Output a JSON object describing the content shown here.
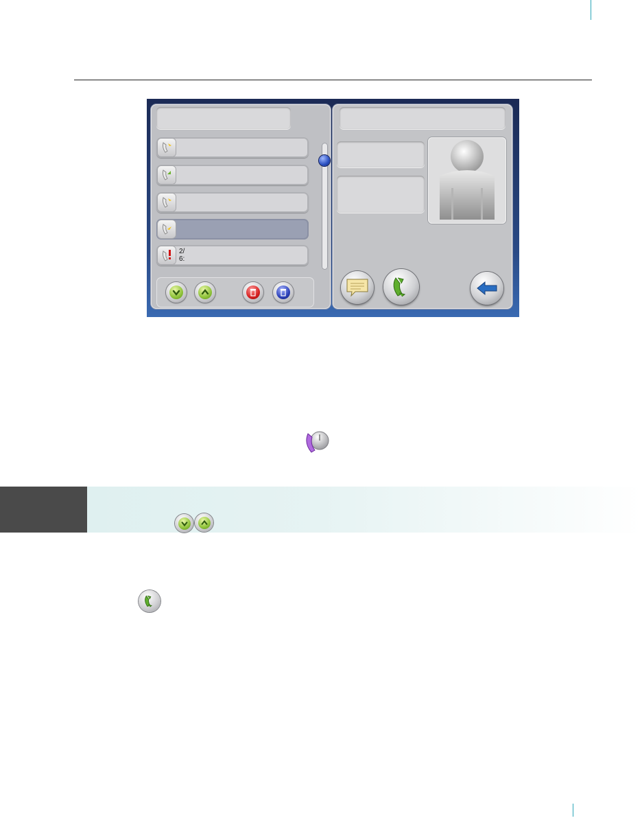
{
  "colors": {
    "accent_rule": "#2aa6b8",
    "screen_bg": "#1b2a55",
    "panel_gray": "#c9c9cc",
    "selected_row": "#9aa0b3",
    "note_band": "#dcefef",
    "note_tab": "#4a4a4a"
  },
  "device": {
    "list": {
      "title": "",
      "rows": [
        {
          "icon": "incoming-call-icon",
          "text": "",
          "selected": false
        },
        {
          "icon": "outgoing-call-icon",
          "text": "",
          "selected": false
        },
        {
          "icon": "incoming-call-icon",
          "text": "",
          "selected": false
        },
        {
          "icon": "outgoing-call-icon",
          "text": "",
          "selected": true
        },
        {
          "icon": "missed-call-icon",
          "text": "2/\n6:"
        }
      ],
      "scroll": {
        "position": 0.05
      },
      "buttons": [
        "scroll-down-icon",
        "scroll-up-icon",
        "delete-one-icon",
        "delete-all-icon"
      ]
    },
    "detail": {
      "name": "",
      "info_1": "",
      "info_2": "",
      "buttons": [
        "message-icon",
        "call-icon",
        "back-arrow-icon"
      ]
    }
  },
  "inline_icons": [
    "call-history-icon",
    "scroll-down-icon",
    "scroll-up-icon",
    "call-icon"
  ]
}
